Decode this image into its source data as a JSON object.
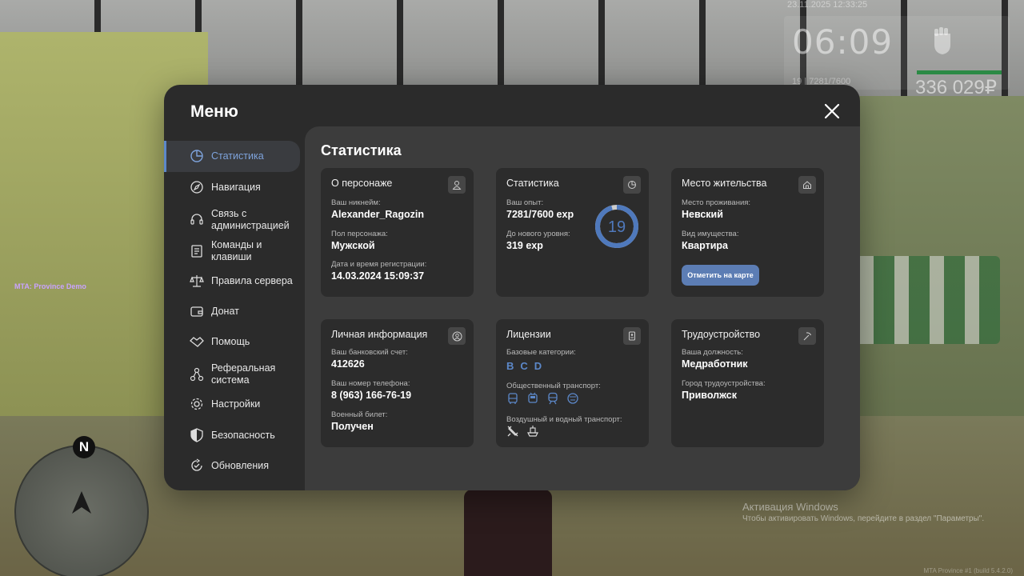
{
  "hud": {
    "date": "23.11.2025 12:33:25",
    "time": "06:09",
    "xp": "19 | 7281/7600",
    "money": "336 029₽",
    "server_label": "MTA: Province Demo",
    "compass": "N",
    "footer": "MTA Province #1 (build 5.4.2.0)"
  },
  "windows_activation": {
    "title": "Активация Windows",
    "subtitle": "Чтобы активировать Windows, перейдите в раздел \"Параметры\"."
  },
  "menu": {
    "title": "Меню",
    "sidebar": [
      {
        "label": "Статистика",
        "icon": "pie-chart-icon",
        "active": true
      },
      {
        "label": "Навигация",
        "icon": "compass-icon"
      },
      {
        "label": "Связь с администрацией",
        "icon": "headset-icon"
      },
      {
        "label": "Команды и клавиши",
        "icon": "document-icon"
      },
      {
        "label": "Правила сервера",
        "icon": "scales-icon"
      },
      {
        "label": "Донат",
        "icon": "wallet-icon"
      },
      {
        "label": "Помощь",
        "icon": "handshake-icon"
      },
      {
        "label": "Реферальная система",
        "icon": "network-icon"
      },
      {
        "label": "Настройки",
        "icon": "gear-icon"
      },
      {
        "label": "Безопасность",
        "icon": "shield-icon"
      },
      {
        "label": "Обновления",
        "icon": "refresh-check-icon"
      }
    ]
  },
  "content": {
    "title": "Статистика",
    "character": {
      "title": "О персонаже",
      "nickname_label": "Ваш никнейм:",
      "nickname": "Alexander_Ragozin",
      "gender_label": "Пол персонажа:",
      "gender": "Мужской",
      "reg_label": "Дата и время регистрации:",
      "reg_date": "14.03.2024 15:09:37"
    },
    "stats": {
      "title": "Статистика",
      "exp_label": "Ваш опыт:",
      "exp": "7281/7600 exp",
      "next_label": "До нового уровня:",
      "next": "319 exp",
      "level": "19",
      "level_progress": 0.958
    },
    "residence": {
      "title": "Место жительства",
      "place_label": "Место проживания:",
      "place": "Невский",
      "property_label": "Вид имущества:",
      "property": "Квартира",
      "map_button": "Отметить на карте"
    },
    "personal": {
      "title": "Личная информация",
      "bank_label": "Ваш банковский счет:",
      "bank": "412626",
      "phone_label": "Ваш номер телефона:",
      "phone": "8 (963) 166-76-19",
      "military_label": "Военный билет:",
      "military": "Получен"
    },
    "licenses": {
      "title": "Лицензии",
      "base_label": "Базовые категории:",
      "base": "BCD",
      "public_label": "Общественный транспорт:",
      "public_icons": [
        "bus-icon",
        "trolleybus-icon",
        "train-icon",
        "tram-icon"
      ],
      "air_label": "Воздушный и водный транспорт:",
      "air_icons": [
        "plane-icon",
        "ship-icon"
      ]
    },
    "employment": {
      "title": "Трудоустройство",
      "position_label": "Ваша должность:",
      "position": "Медработник",
      "city_label": "Город трудоустройства:",
      "city": "Приволжск"
    }
  },
  "colors": {
    "accent": "#5c88c9",
    "panel": "#2b2b2b",
    "content": "#3c3c3c",
    "card": "#2c2c2c"
  }
}
